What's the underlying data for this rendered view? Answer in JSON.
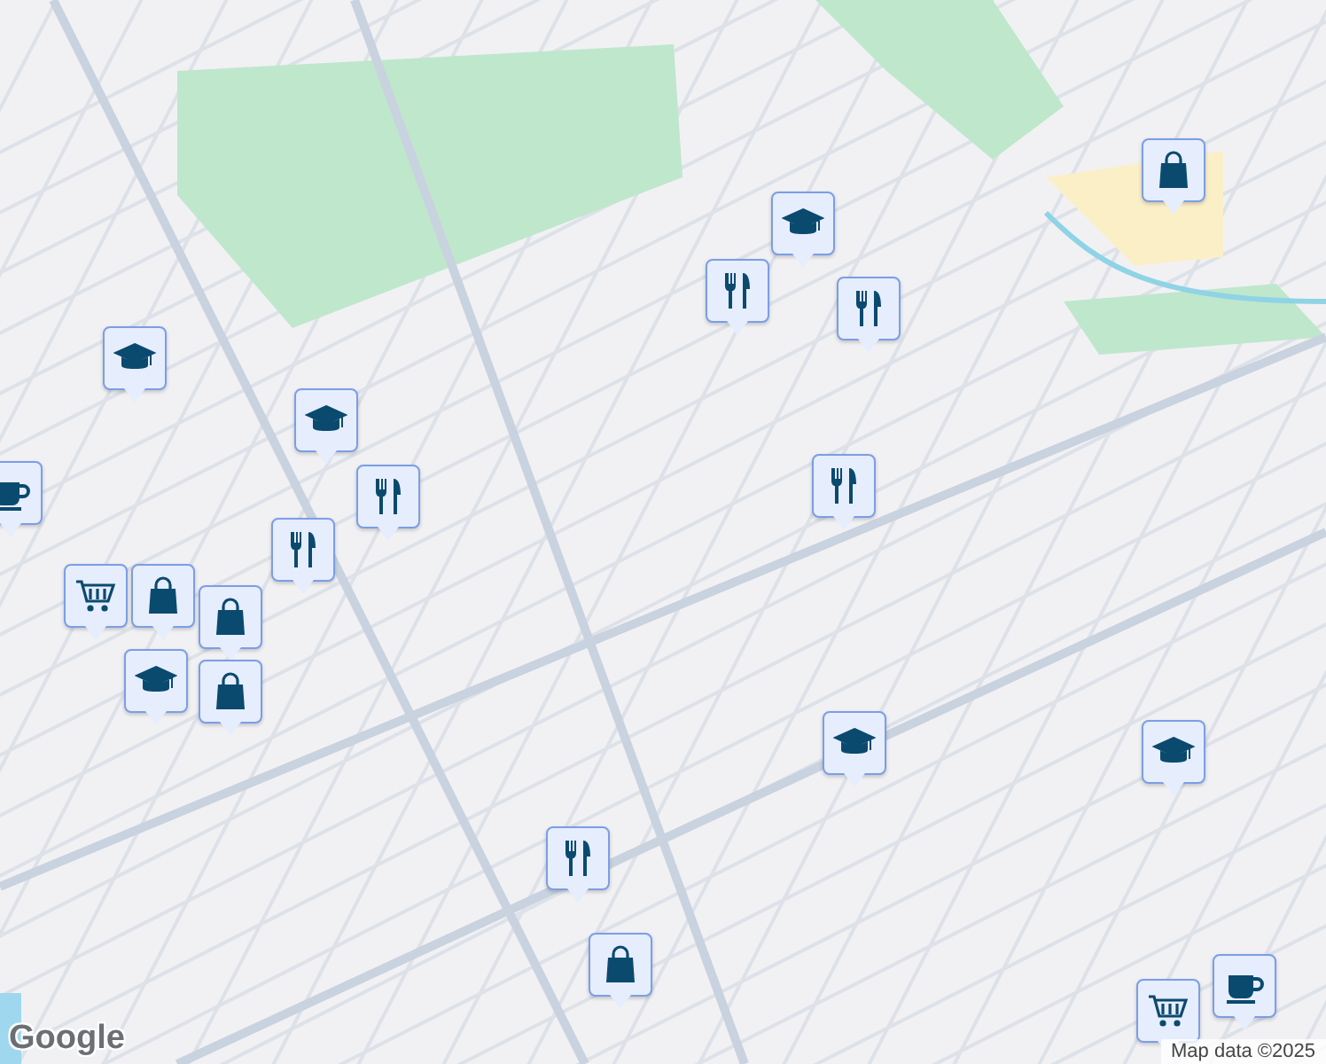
{
  "map": {
    "markers": [
      {
        "kind": "school"
      },
      {
        "kind": "school"
      },
      {
        "kind": "restaurant"
      },
      {
        "kind": "restaurant"
      },
      {
        "kind": "cafe"
      },
      {
        "kind": "shopping"
      },
      {
        "kind": "shopping"
      },
      {
        "kind": "shopping"
      },
      {
        "kind": "cart"
      },
      {
        "kind": "school"
      },
      {
        "kind": "school"
      },
      {
        "kind": "restaurant"
      },
      {
        "kind": "restaurant"
      },
      {
        "kind": "restaurant"
      },
      {
        "kind": "school"
      },
      {
        "kind": "school"
      },
      {
        "kind": "restaurant"
      },
      {
        "kind": "shopping"
      },
      {
        "kind": "shopping"
      },
      {
        "kind": "cart"
      },
      {
        "kind": "cafe"
      }
    ]
  },
  "logo": "Google",
  "attribution": "Map data ©2025"
}
